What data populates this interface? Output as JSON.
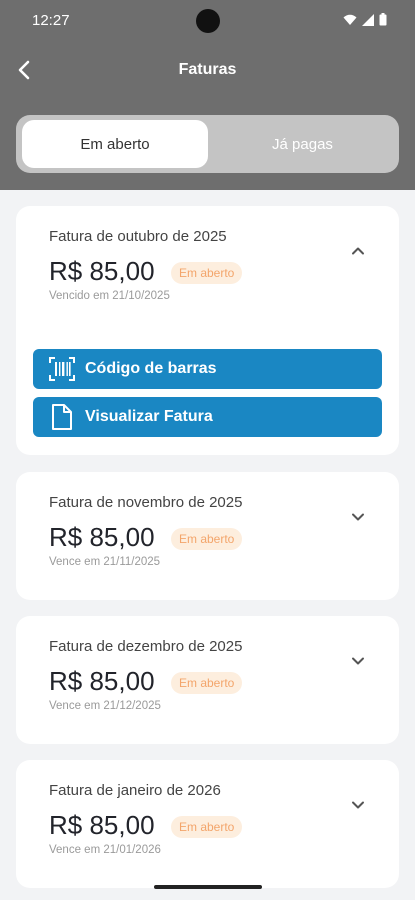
{
  "status_bar": {
    "time": "12:27"
  },
  "header": {
    "title": "Faturas"
  },
  "tabs": [
    {
      "label": "Em aberto"
    },
    {
      "label": "Já pagas"
    }
  ],
  "invoices": [
    {
      "title": "Fatura de outubro de 2025",
      "amount": "R$ 85,00",
      "badge": "Em aberto",
      "due": "Vencido em 21/10/2025"
    },
    {
      "title": "Fatura de novembro de 2025",
      "amount": "R$ 85,00",
      "badge": "Em aberto",
      "due": "Vence em 21/11/2025"
    },
    {
      "title": "Fatura de dezembro de 2025",
      "amount": "R$ 85,00",
      "badge": "Em aberto",
      "due": "Vence em 21/12/2025"
    },
    {
      "title": "Fatura de janeiro de 2026",
      "amount": "R$ 85,00",
      "badge": "Em aberto",
      "due": "Vence em 21/01/2026"
    }
  ],
  "actions": {
    "barcode_label": "Código de barras",
    "view_label": "Visualizar Fatura"
  },
  "colors": {
    "header": "#6e6e6e",
    "accent": "#1a87c3",
    "badge_bg": "#fdeede",
    "badge_text": "#f3a56b"
  },
  "icons": {
    "back": "arrow-left-icon",
    "barcode": "barcode-icon",
    "document": "document-icon",
    "collapse": "chevron-up-icon",
    "expand": "chevron-down-icon"
  }
}
